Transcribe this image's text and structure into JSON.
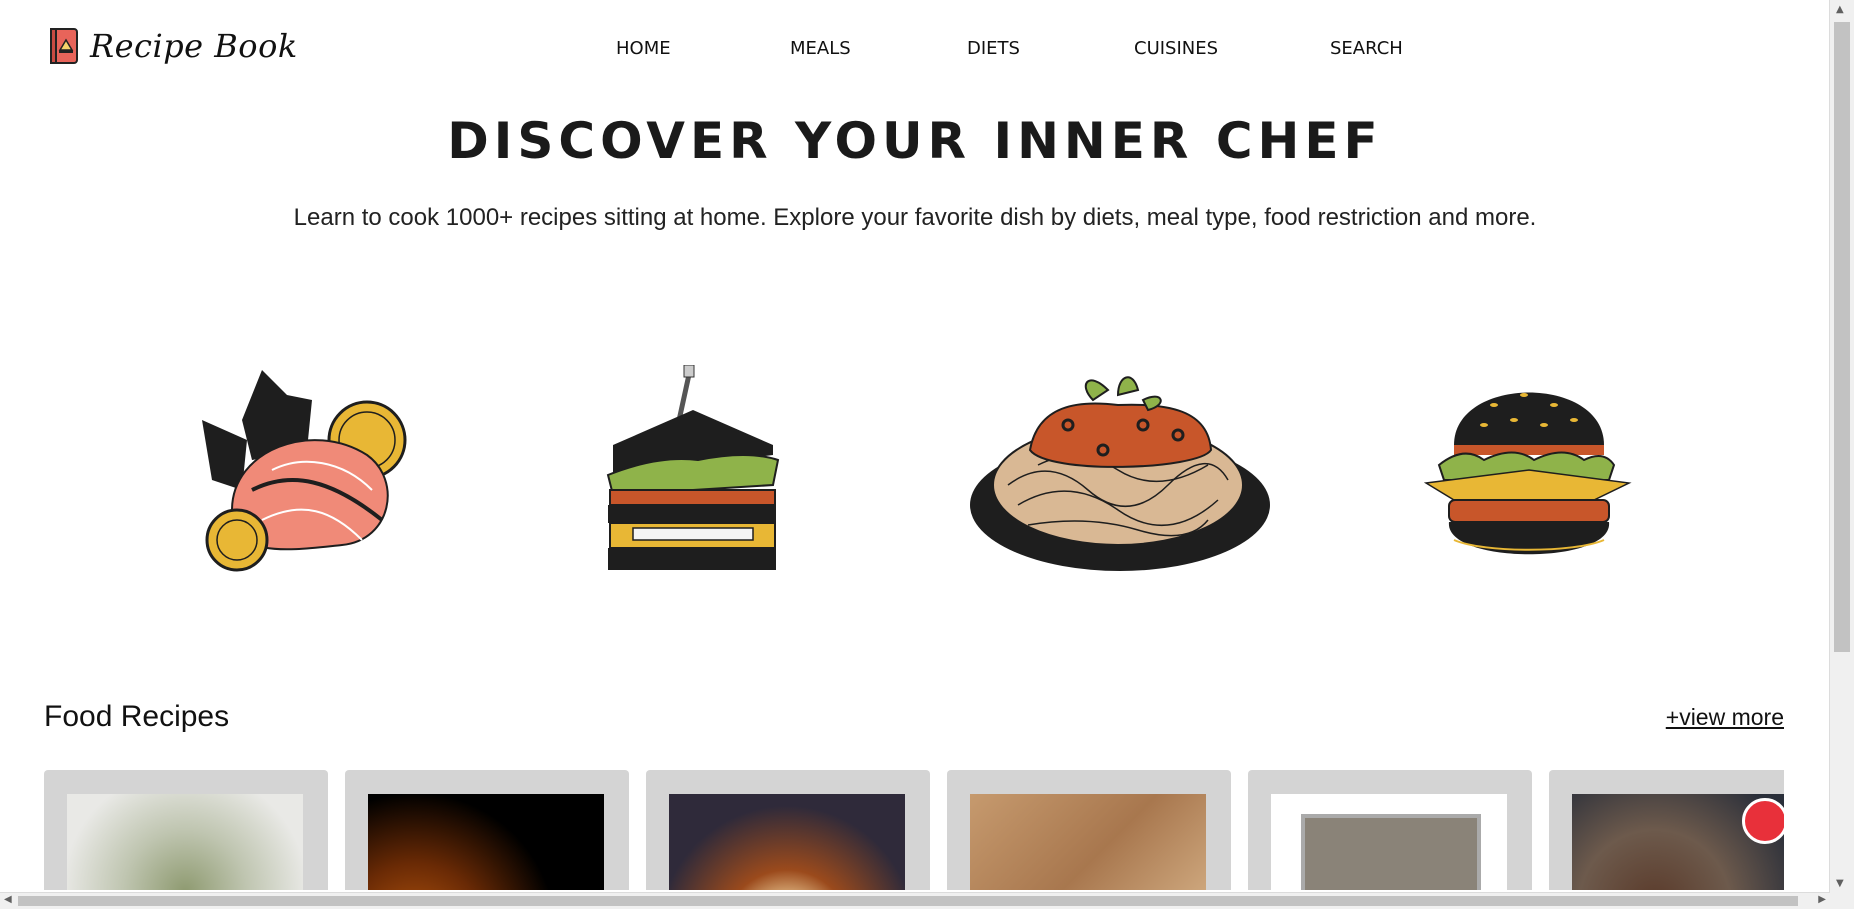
{
  "brand": {
    "name": "Recipe Book"
  },
  "nav": {
    "items": [
      "HOME",
      "MEALS",
      "DIETS",
      "CUISINES",
      "SEARCH"
    ]
  },
  "hero": {
    "title": "DISCOVER YOUR INNER CHEF",
    "subtitle": "Learn to cook 1000+ recipes sitting at home. Explore your favorite dish by diets, meal type, food restriction and more."
  },
  "illustrations": [
    "salmon-lemon-icon",
    "club-sandwich-icon",
    "spaghetti-icon",
    "burger-icon"
  ],
  "recipes": {
    "title": "Food Recipes",
    "view_more": "+view more"
  },
  "colors": {
    "brand_red": "#e8645a",
    "card_bg": "#d4d4d4",
    "salmon": "#f08a78",
    "lemon": "#e8b735",
    "sauce": "#c8562a",
    "dark": "#1e1e1e",
    "lettuce": "#8fb34a"
  }
}
